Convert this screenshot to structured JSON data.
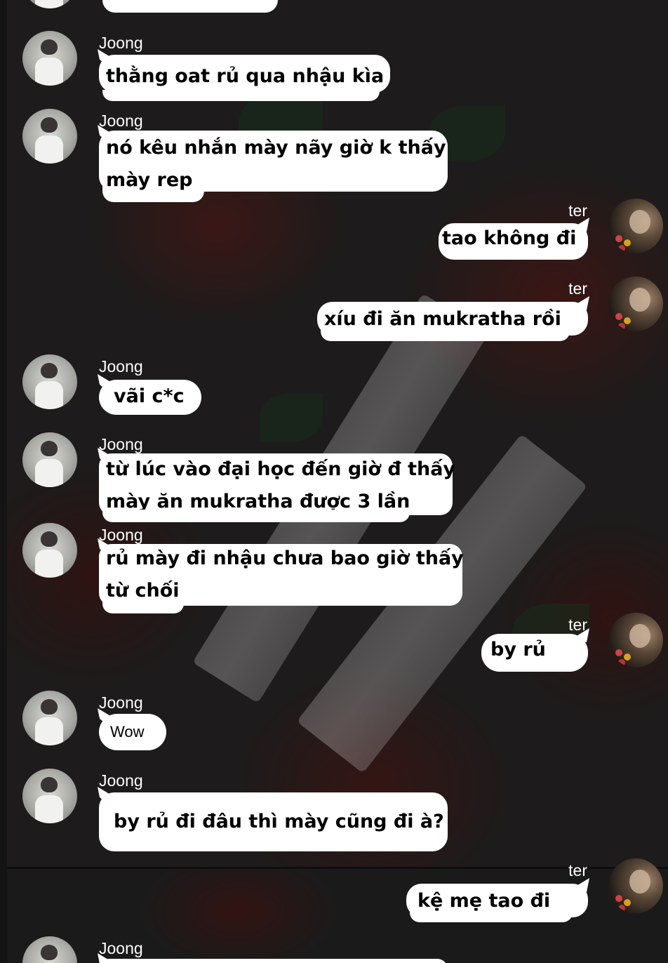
{
  "chat": {
    "participants": {
      "left": "Joong",
      "right": "ter"
    },
    "messages": [
      {
        "sender": "Joong",
        "text": "thằng oat rủ qua nhậu kìa"
      },
      {
        "sender": "Joong",
        "lines": [
          "nó kêu nhắn mày nãy giờ k thấy",
          "mày rep"
        ]
      },
      {
        "sender": "ter",
        "text": "tao không đi"
      },
      {
        "sender": "ter",
        "text": "xíu đi ăn mukratha rồi"
      },
      {
        "sender": "Joong",
        "text": "vãi c*c"
      },
      {
        "sender": "Joong",
        "lines": [
          "từ lúc vào đại học đến giờ đ thấy",
          "mày ăn mukratha được 3 lần"
        ]
      },
      {
        "sender": "Joong",
        "lines": [
          "rủ mày đi nhậu chưa bao giờ thấy",
          "từ chối"
        ]
      },
      {
        "sender": "ter",
        "text": "by rủ"
      },
      {
        "sender": "Joong",
        "text": "Wow"
      },
      {
        "sender": "Joong",
        "text": "by rủ đi đâu thì mày cũng đi à?"
      },
      {
        "sender": "ter",
        "text": "kệ mẹ tao đi"
      },
      {
        "sender": "Joong",
        "text": ""
      }
    ]
  },
  "colors": {
    "bubble": "#ffffff",
    "text_on_bubble": "#000000",
    "name_text": "#ffffff",
    "background": "#1d1b1b"
  },
  "icons": {
    "joong_avatar": "avatar-joong",
    "ter_avatar": "avatar-ter"
  }
}
